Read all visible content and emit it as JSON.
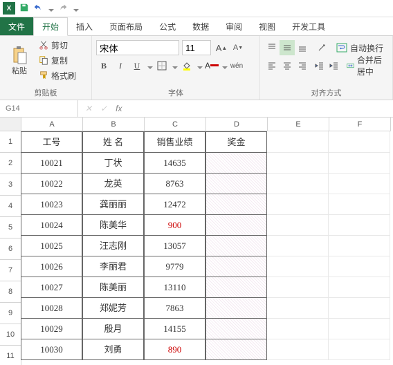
{
  "qat": {
    "app_initial": "X"
  },
  "tabs": {
    "file": "文件",
    "items": [
      "开始",
      "插入",
      "页面布局",
      "公式",
      "数据",
      "审阅",
      "视图",
      "开发工具"
    ],
    "active_index": 0
  },
  "ribbon": {
    "clipboard": {
      "label": "剪贴板",
      "paste": "粘贴",
      "cut": "剪切",
      "copy": "复制",
      "format_painter": "格式刷"
    },
    "font": {
      "label": "字体",
      "name": "宋体",
      "size": "11",
      "bold": "B",
      "italic": "I",
      "underline": "U",
      "phonetic": "wén"
    },
    "align": {
      "label": "对齐方式",
      "wrap": "自动换行",
      "merge": "合并后居中"
    }
  },
  "namebox": {
    "ref": "G14"
  },
  "columns": [
    "A",
    "B",
    "C",
    "D",
    "E",
    "F"
  ],
  "chart_data": {
    "type": "table",
    "headers": [
      "工号",
      "姓 名",
      "销售业绩",
      "奖金"
    ],
    "rows": [
      {
        "id": "10021",
        "name": "丁状",
        "sales": "14635",
        "bonus": ""
      },
      {
        "id": "10022",
        "name": "龙英",
        "sales": "8763",
        "bonus": ""
      },
      {
        "id": "10023",
        "name": "龚丽丽",
        "sales": "12472",
        "bonus": ""
      },
      {
        "id": "10024",
        "name": "陈美华",
        "sales": "900",
        "bonus": "",
        "sales_red": true
      },
      {
        "id": "10025",
        "name": "汪志刚",
        "sales": "13057",
        "bonus": ""
      },
      {
        "id": "10026",
        "name": "李丽君",
        "sales": "9779",
        "bonus": ""
      },
      {
        "id": "10027",
        "name": "陈美丽",
        "sales": "13110",
        "bonus": ""
      },
      {
        "id": "10028",
        "name": "郑妮芳",
        "sales": "7863",
        "bonus": ""
      },
      {
        "id": "10029",
        "name": "殷月",
        "sales": "14155",
        "bonus": ""
      },
      {
        "id": "10030",
        "name": "刘勇",
        "sales": "890",
        "bonus": "",
        "sales_red": true
      }
    ]
  }
}
